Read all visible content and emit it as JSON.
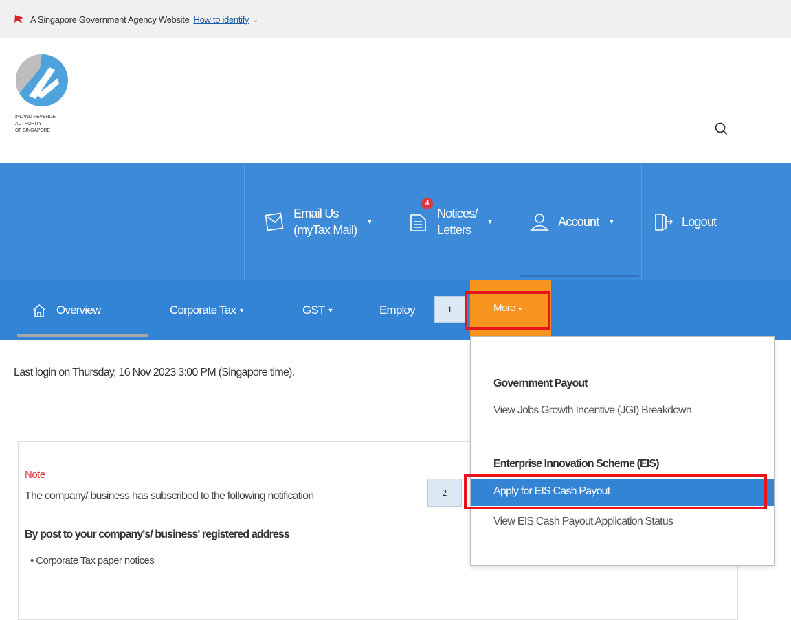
{
  "masthead": {
    "text": "A Singapore Government Agency Website",
    "link": "How to identify",
    "chevron": "⌄"
  },
  "logo": {
    "line1": "INLAND REVENUE",
    "line2": "AUTHORITY",
    "line3": "OF SINGAPORE"
  },
  "topbar": {
    "email": {
      "line1": "Email Us",
      "line2": "(myTax Mail)"
    },
    "notices": {
      "line1": "Notices/",
      "line2": "Letters",
      "badge": "4"
    },
    "account": "Account",
    "logout": "Logout",
    "caret": "▼"
  },
  "nav": {
    "overview": "Overview",
    "corporate_tax": "Corporate Tax",
    "gst": "GST",
    "employer": "Employ",
    "more": "More",
    "caret": "▼"
  },
  "steps": {
    "one": "1",
    "two": "2"
  },
  "main": {
    "last_login": "Last login on Thursday, 16 Nov 2023 3:00 PM (Singapore time).",
    "note_title": "Note",
    "note_text": "The company/ business has subscribed to the following notification",
    "note_sub": "By post to your company's/ business' registered address",
    "note_bullet": "• Corporate Tax paper notices"
  },
  "dropdown": {
    "gov_heading": "Government Payout",
    "jgi_link": "View Jobs Growth Incentive (JGI) Breakdown",
    "eis_heading": "Enterprise Innovation Scheme (EIS)",
    "apply_link": "Apply for EIS Cash Payout",
    "status_link": "View EIS Cash Payout Application Status"
  },
  "colors": {
    "topbar_blue": "#3d8bd8",
    "nav_blue": "#3484d6",
    "more_orange": "#f7941d",
    "highlight_red": "#e8141c",
    "note_red": "#d9353a"
  }
}
